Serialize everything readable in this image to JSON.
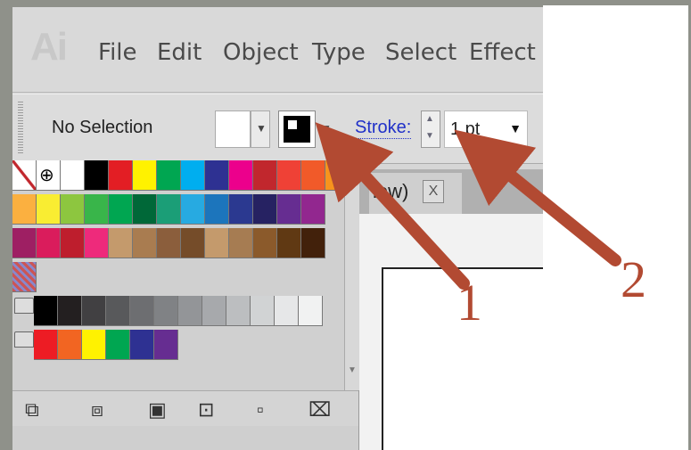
{
  "app": {
    "logo": "Ai"
  },
  "menu": {
    "items": [
      "File",
      "Edit",
      "Object",
      "Type",
      "Select",
      "Effect"
    ]
  },
  "control_bar": {
    "selection_status": "No Selection",
    "stroke_label": "Stroke:",
    "stroke_weight": "1 pt"
  },
  "document_tab": {
    "label": "iew)",
    "close": "X"
  },
  "annotations": {
    "label_1": "1",
    "label_2": "2"
  },
  "colors": {
    "arrow": "#b24a32"
  }
}
